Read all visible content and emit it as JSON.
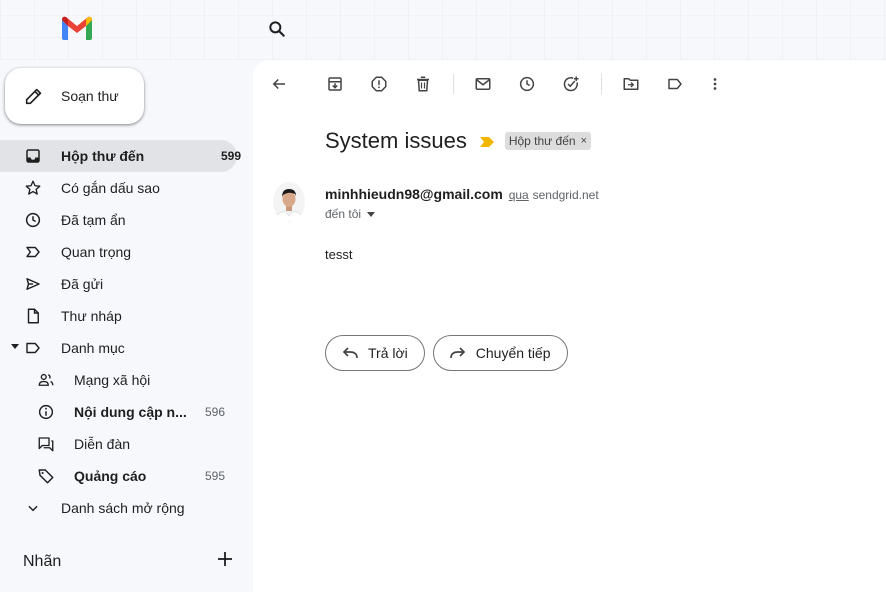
{
  "app": {
    "name": "Gmail"
  },
  "compose": {
    "label": "Soạn thư"
  },
  "nav": {
    "items": [
      {
        "label": "Hộp thư đến",
        "count": "599"
      },
      {
        "label": "Có gắn dấu sao"
      },
      {
        "label": "Đã tạm ẩn"
      },
      {
        "label": "Quan trọng"
      },
      {
        "label": "Đã gửi"
      },
      {
        "label": "Thư nháp"
      },
      {
        "label": "Danh mục"
      },
      {
        "label": "Mạng xã hội"
      },
      {
        "label": "Nội dung cập n...",
        "count": "596"
      },
      {
        "label": "Diễn đàn"
      },
      {
        "label": "Quảng cáo",
        "count": "595"
      },
      {
        "label": "Danh sách mở rộng"
      }
    ]
  },
  "labels": {
    "title": "Nhãn"
  },
  "message": {
    "subject": "System issues",
    "label_chip": "Hộp thư đến",
    "label_chip_close": "×",
    "sender_email": "minhhieudn98@gmail.com",
    "via": "qua",
    "via_domain": "sendgrid.net",
    "to": "đến tôi",
    "body": "tesst"
  },
  "actions": {
    "reply": "Trả lời",
    "forward": "Chuyển tiếp"
  },
  "colors": {
    "importance_marker": "#f2b600",
    "active_bg": "#e1e3e6",
    "background": "#f6f8fc"
  }
}
